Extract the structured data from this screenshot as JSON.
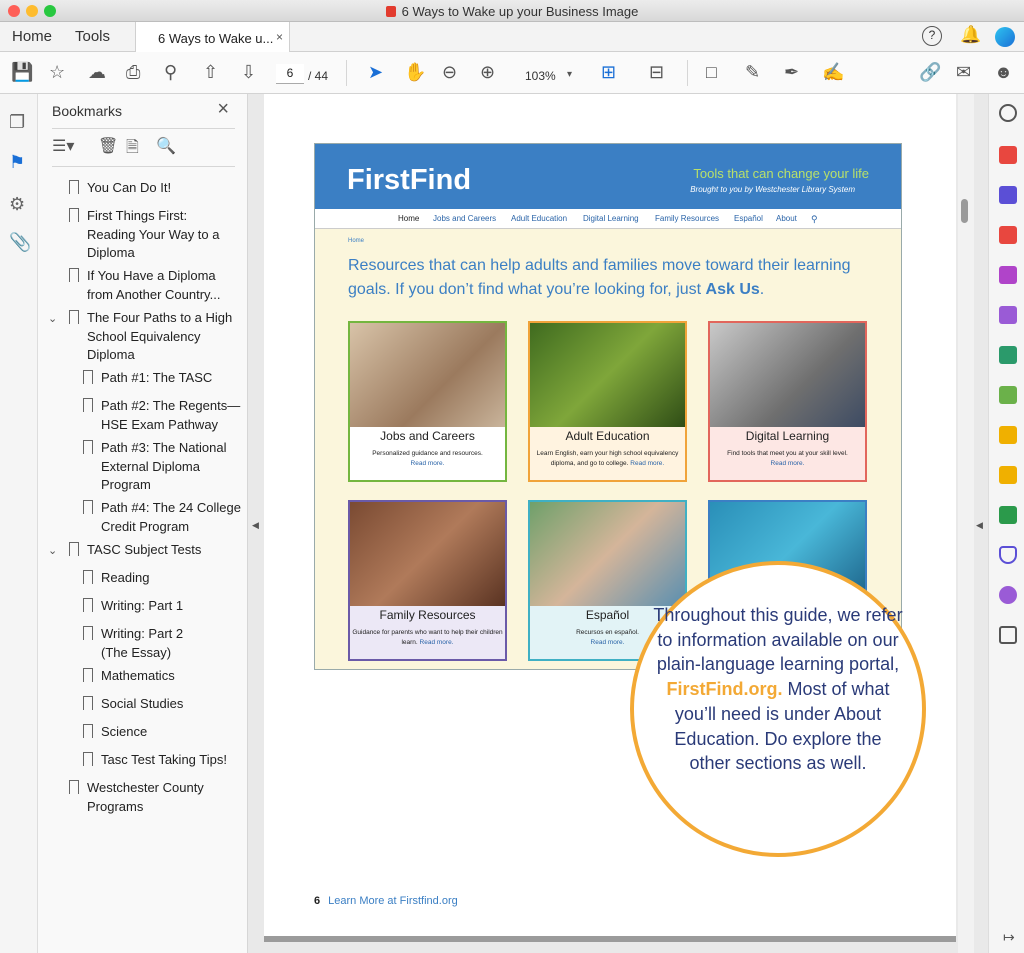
{
  "window": {
    "title": "6 Ways to Wake up your Business Image"
  },
  "tabs": {
    "home": "Home",
    "tools": "Tools",
    "doc": "6 Ways to Wake u...",
    "close": "×"
  },
  "toolbar": {
    "page_current": "6",
    "page_total": "/ 44",
    "zoom": "103%"
  },
  "bookmarks": {
    "title": "Bookmarks",
    "items": [
      {
        "label": "You Can Do It!"
      },
      {
        "label": "First Things First: Reading Your Way to a Diploma"
      },
      {
        "label": "If You Have a Diploma from Another Country..."
      },
      {
        "label": "The Four Paths to a High School Equivalency Diploma"
      },
      {
        "label": "Path #1: The TASC"
      },
      {
        "label": "Path #2: The Regents—HSE Exam Pathway"
      },
      {
        "label": "Path #3: The National External Diploma Program"
      },
      {
        "label": "Path #4: The 24 College Credit Program"
      },
      {
        "label": "TASC Subject Tests"
      },
      {
        "label": "Reading"
      },
      {
        "label": "Writing:  Part 1"
      },
      {
        "label": "Writing: Part 2 (The Essay)"
      },
      {
        "label": "Mathematics"
      },
      {
        "label": "Social Studies"
      },
      {
        "label": "Science"
      },
      {
        "label": "Tasc Test Taking Tips!"
      },
      {
        "label": "Westchester County Programs"
      }
    ]
  },
  "site": {
    "logo": "FirstFind",
    "tagline": "Tools that can change your life",
    "subtag": "Brought to you by Westchester Library System",
    "nav": [
      "Home",
      "Jobs and Careers",
      "Adult Education",
      "Digital Learning",
      "Family Resources",
      "Español",
      "About"
    ],
    "crumb": "Home",
    "intro": "Resources that can help adults and families move toward their learning goals. If you don’t find what you’re looking for, just ",
    "intro_link": "Ask Us",
    "intro_end": ".",
    "cards": [
      {
        "title": "Jobs and Careers",
        "desc": "Personalized guidance and resources.",
        "more": "Read more."
      },
      {
        "title": "Adult Education",
        "desc": "Learn English, earn your high school equivalency diploma, and go to college.",
        "more": "Read more."
      },
      {
        "title": "Digital Learning",
        "desc": "Find tools that meet you at your skill level.",
        "more": "Read more."
      },
      {
        "title": "Family Resources",
        "desc": "Guidance for parents who want to help their children learn.",
        "more": "Read more."
      },
      {
        "title": "Español",
        "desc": "Recursos en español.",
        "more": "Read more."
      }
    ]
  },
  "callout": {
    "pre": "Throughout this guide, we refer to information available on our plain-language learning portal,",
    "link": "FirstFind.org.",
    "post": "Most of what you’ll need is under About Education. Do explore the other sections as well."
  },
  "footer": {
    "page": "6",
    "text": "Learn More at Firstfind.org"
  },
  "colors": {
    "brand_blue": "#3b7fc4",
    "callout_orange": "#f3a935",
    "navy": "#2a3a78"
  }
}
